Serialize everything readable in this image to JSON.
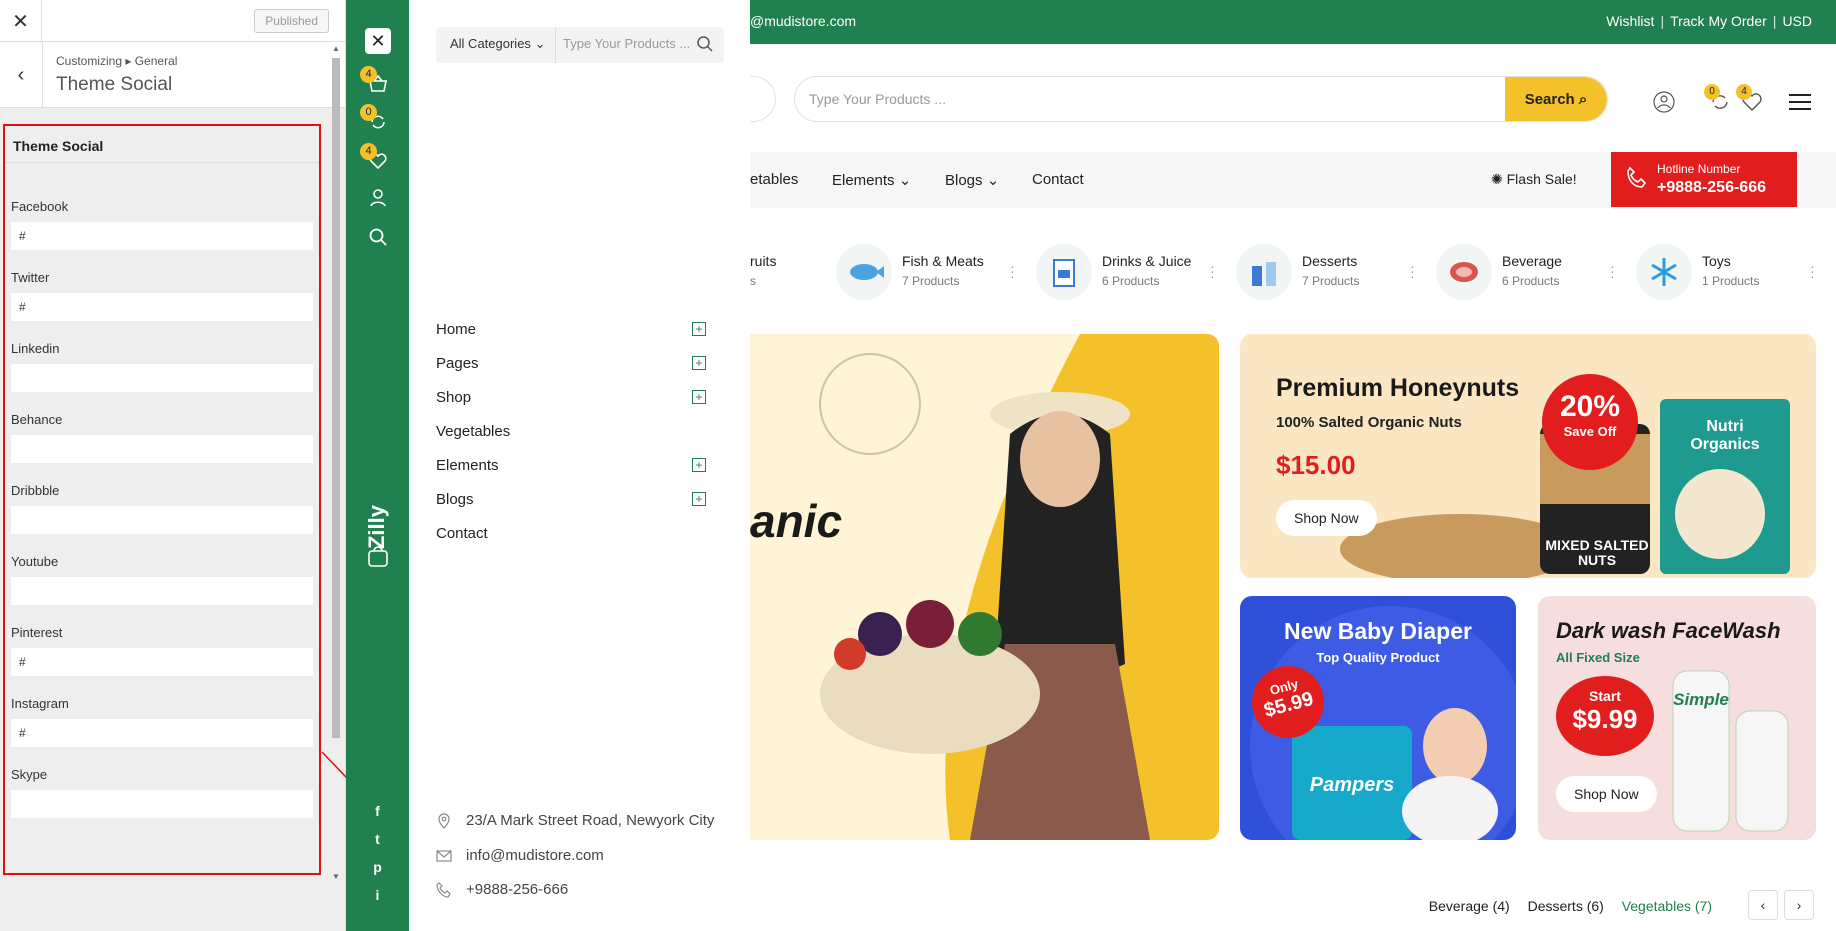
{
  "customizer": {
    "close_icon": "close-icon",
    "publish_label": "Published",
    "breadcrumb": "Customizing ▸ General",
    "title": "Theme Social",
    "section_title": "Theme Social",
    "fields": [
      {
        "label": "Facebook",
        "value": "#"
      },
      {
        "label": "Twitter",
        "value": "#"
      },
      {
        "label": "Linkedin",
        "value": ""
      },
      {
        "label": "Behance",
        "value": ""
      },
      {
        "label": "Dribbble",
        "value": ""
      },
      {
        "label": "Youtube",
        "value": ""
      },
      {
        "label": "Pinterest",
        "value": "#"
      },
      {
        "label": "Instagram",
        "value": "#"
      },
      {
        "label": "Skype",
        "value": ""
      }
    ]
  },
  "greenbar": {
    "cart_count": "4",
    "compare_count": "0",
    "wishlist_count": "4",
    "brand": "Zilly",
    "social": [
      "f",
      "t",
      "p",
      "i"
    ]
  },
  "offcanvas": {
    "category_label": "All Categories",
    "search_placeholder": "Type Your Products ...",
    "menu": [
      {
        "label": "Home",
        "plus": true
      },
      {
        "label": "Pages",
        "plus": true
      },
      {
        "label": "Shop",
        "plus": true
      },
      {
        "label": "Vegetables",
        "plus": false
      },
      {
        "label": "Elements",
        "plus": true
      },
      {
        "label": "Blogs",
        "plus": true
      },
      {
        "label": "Contact",
        "plus": false
      }
    ],
    "contact": {
      "address": "23/A Mark Street Road, Newyork City",
      "email": "info@mudistore.com",
      "phone": "+9888-256-666"
    }
  },
  "site": {
    "topbar_email": "@mudistore.com",
    "topbar_links": [
      "Wishlist",
      "Track My Order",
      "USD"
    ],
    "search_placeholder": "Type Your Products ...",
    "search_button": "Search",
    "compare_count": "0",
    "wishlist_count": "4",
    "nav": [
      "etables",
      "Elements",
      "Blogs",
      "Contact"
    ],
    "flash_sale": "Flash Sale!",
    "hotline_title": "Hotline Number",
    "hotline_number": "+9888-256-666",
    "categories": [
      {
        "name": "ruits",
        "count": "s"
      },
      {
        "name": "Fish & Meats",
        "count": "7 Products"
      },
      {
        "name": "Drinks & Juice",
        "count": "6 Products"
      },
      {
        "name": "Desserts",
        "count": "7 Products"
      },
      {
        "name": "Beverage",
        "count": "6 Products"
      },
      {
        "name": "Toys",
        "count": "1 Products"
      }
    ],
    "hero_text": "anic",
    "banner1": {
      "title": "Premium Honeynuts",
      "subtitle": "100% Salted Organic Nuts",
      "price": "$15.00",
      "badge_big": "20%",
      "badge_small": "Save Off",
      "jar_text": "MIXED SALTED NUTS",
      "pack_text": "Nutri Organics",
      "button": "Shop Now"
    },
    "banner2": {
      "title": "New Baby Diaper",
      "subtitle": "Top Quality Product",
      "badge_small": "Only",
      "badge_big": "$5.99",
      "pack_text": "Pampers"
    },
    "banner3": {
      "title": "Dark wash FaceWash",
      "subtitle": "All Fixed Size",
      "badge_small": "Start",
      "badge_big": "$9.99",
      "pack_text": "Simple",
      "button": "Shop Now"
    },
    "tabs": [
      "Beverage (4)",
      "Desserts (6)",
      "Vegetables (7)"
    ],
    "colors": {
      "green": "#218050",
      "yellow": "#f4c12a",
      "red": "#e21d1d"
    }
  }
}
